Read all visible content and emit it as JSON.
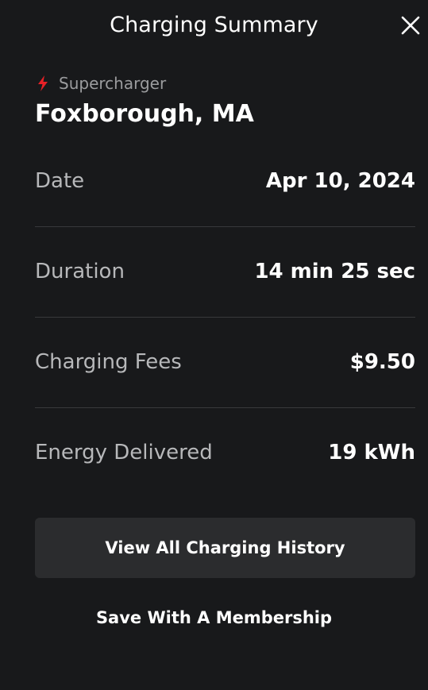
{
  "header": {
    "title": "Charging Summary"
  },
  "location": {
    "type": "Supercharger",
    "name": "Foxborough, MA"
  },
  "rows": [
    {
      "label": "Date",
      "value": "Apr 10, 2024"
    },
    {
      "label": "Duration",
      "value": "14 min 25 sec"
    },
    {
      "label": "Charging Fees",
      "value": "$9.50"
    },
    {
      "label": "Energy Delivered",
      "value": "19 kWh"
    }
  ],
  "actions": {
    "history_label": "View All Charging History",
    "membership_label": "Save With A Membership"
  },
  "icons": {
    "bolt": "lightning-bolt-icon",
    "close": "close-icon"
  },
  "colors": {
    "background": "#18191b",
    "accent_red": "#e82127",
    "button_bg": "#2b2c2e",
    "divider": "#38393c"
  }
}
